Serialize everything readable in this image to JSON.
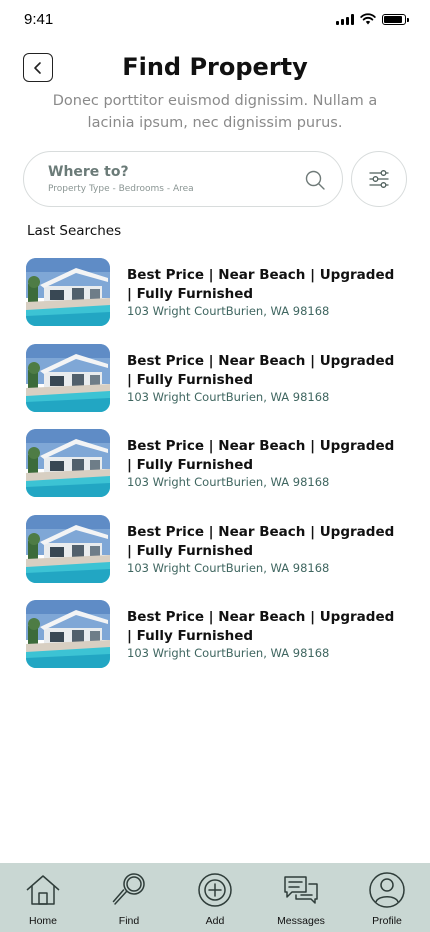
{
  "status_bar": {
    "time": "9:41",
    "battery_level": 0.9
  },
  "header": {
    "title": "Find Property",
    "subtitle": "Donec porttitor euismod dignissim. Nullam a lacinia ipsum, nec dignissim purus.",
    "back_icon": "chevron-left-icon"
  },
  "search": {
    "title": "Where to?",
    "hint": "Property Type - Bedrooms - Area",
    "search_icon": "search-icon",
    "filter_icon": "sliders-icon"
  },
  "last_searches": {
    "label": "Last Searches",
    "items": [
      {
        "title": "Best Price | Near Beach | Upgraded | Fully Furnished",
        "address": "103 Wright CourtBurien, WA 98168"
      },
      {
        "title": "Best Price | Near Beach | Upgraded | Fully Furnished",
        "address": "103 Wright CourtBurien, WA 98168"
      },
      {
        "title": "Best Price | Near Beach | Upgraded | Fully Furnished",
        "address": "103 Wright CourtBurien, WA 98168"
      },
      {
        "title": "Best Price | Near Beach | Upgraded | Fully Furnished",
        "address": "103 Wright CourtBurien, WA 98168"
      },
      {
        "title": "Best Price | Near Beach | Upgraded | Fully Furnished",
        "address": "103 Wright CourtBurien, WA 98168"
      }
    ]
  },
  "bottom_nav": {
    "items": [
      {
        "label": "Home",
        "icon": "home-icon"
      },
      {
        "label": "Find",
        "icon": "magnifier-icon"
      },
      {
        "label": "Add",
        "icon": "plus-circle-icon"
      },
      {
        "label": "Messages",
        "icon": "chat-bubbles-icon"
      },
      {
        "label": "Profile",
        "icon": "user-circle-icon"
      }
    ]
  },
  "colors": {
    "nav_background": "#c9d7d3",
    "address_text": "#3f6660",
    "subtitle_text": "#8a8a8a",
    "border": "#d8dcdc"
  }
}
